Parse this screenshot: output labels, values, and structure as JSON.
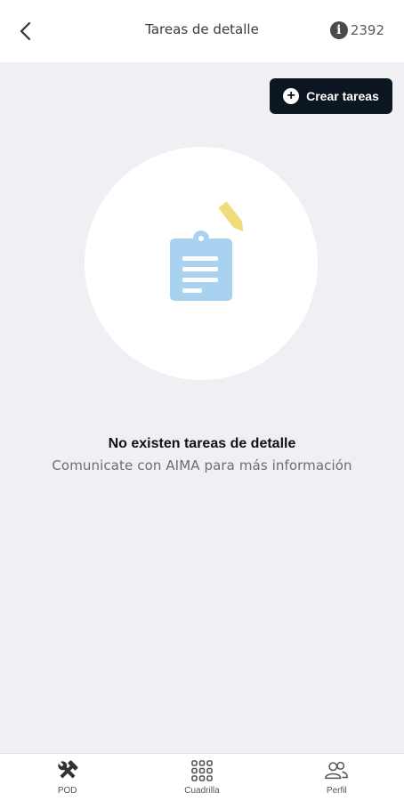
{
  "header": {
    "title": "Tareas de detalle",
    "code": "2392",
    "info_glyph": "i",
    "back_icon": "chevron-left-icon"
  },
  "actions": {
    "create_label": "Crear tareas",
    "create_icon": "plus-circle-icon"
  },
  "empty_state": {
    "icon": "clipboard-edit-icon",
    "title": "No existen tareas de detalle",
    "subtitle": "Comunicate con AIMA para más información"
  },
  "bottom_nav": {
    "items": [
      {
        "label": "POD",
        "icon": "tools-icon"
      },
      {
        "label": "Cuadrilla",
        "icon": "grid-icon"
      },
      {
        "label": "Perfil",
        "icon": "users-icon"
      }
    ]
  },
  "colors": {
    "background": "#efeff4",
    "primary_button": "#0c1620",
    "clipboard": "#a9d1f0",
    "pencil": "#f1dc7a"
  }
}
